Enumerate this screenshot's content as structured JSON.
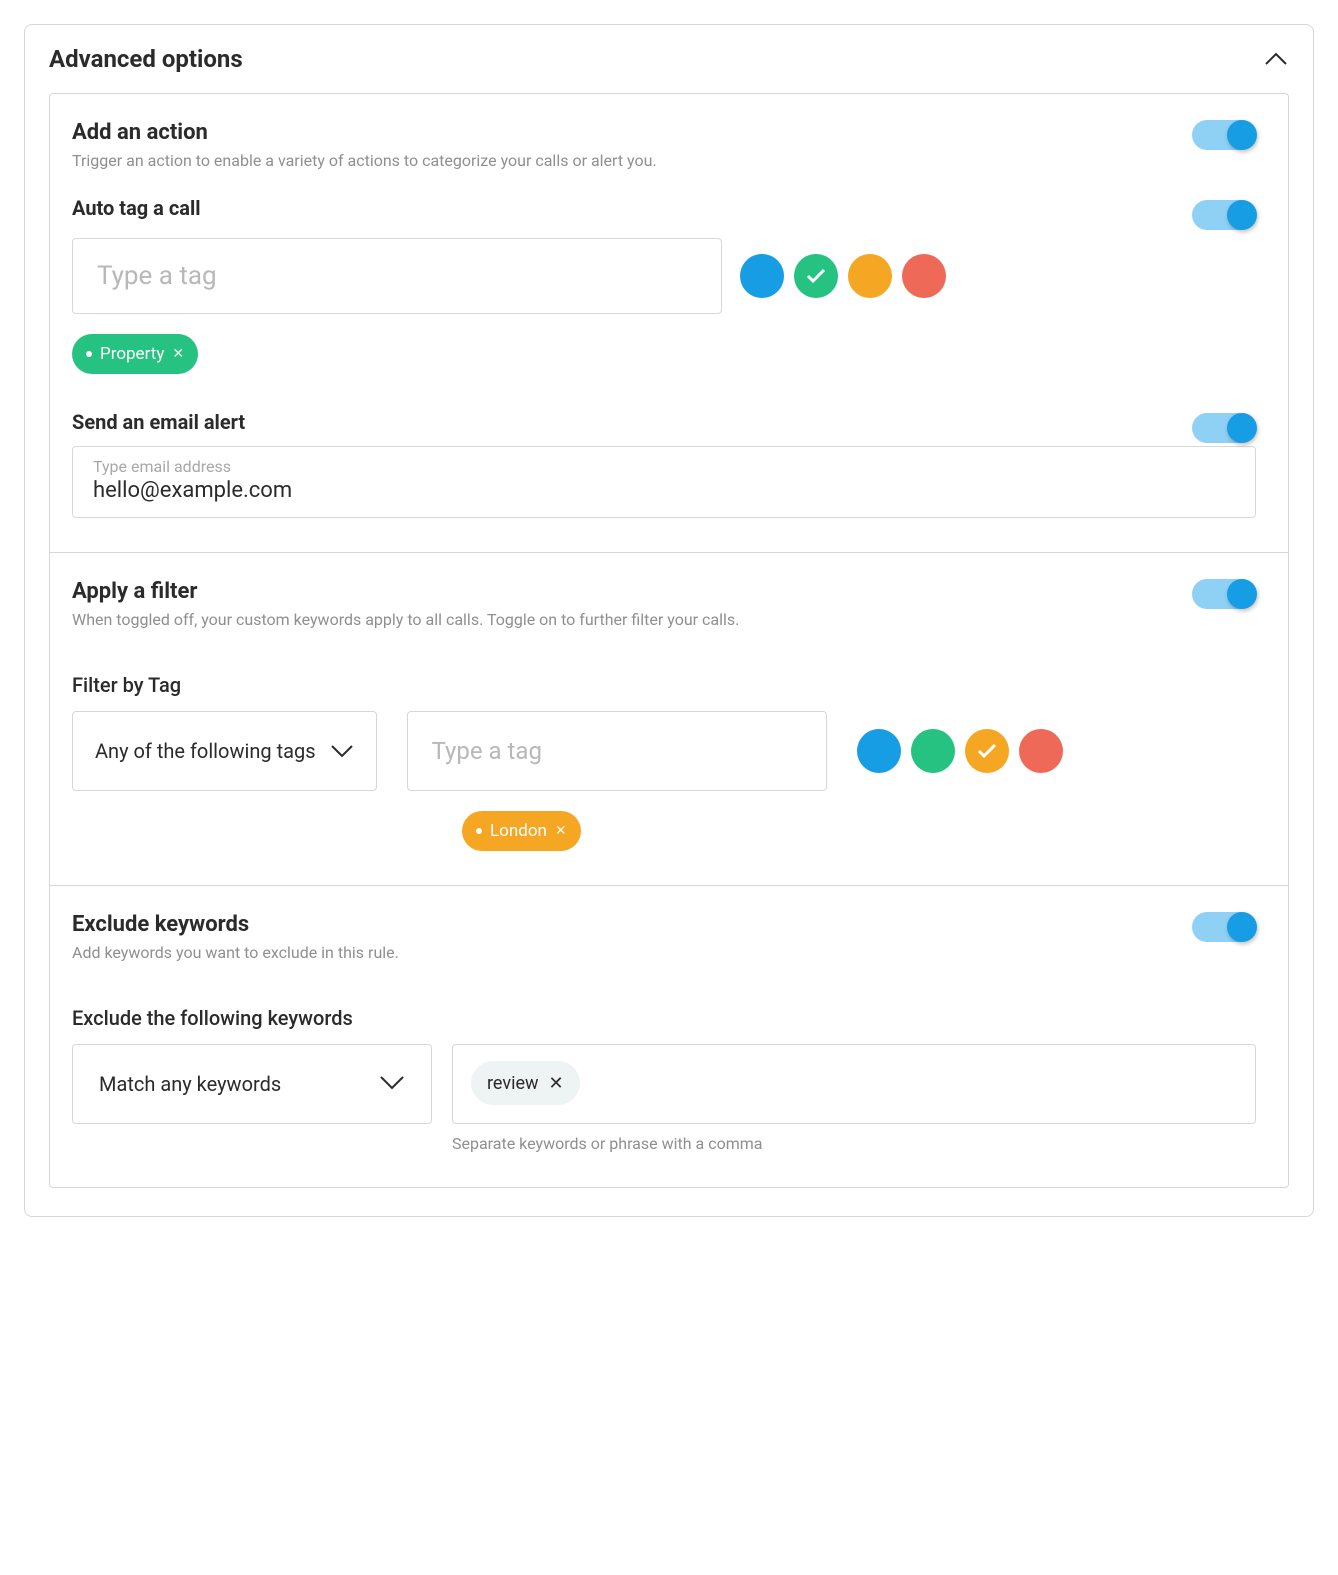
{
  "header": {
    "title": "Advanced options"
  },
  "action": {
    "title": "Add an action",
    "desc": "Trigger an action to enable a variety of actions to categorize your calls or alert you.",
    "autotag": {
      "title": "Auto tag a call",
      "placeholder": "Type a tag",
      "colors": [
        "blue",
        "green",
        "orange",
        "red"
      ],
      "selected_color_index": 1,
      "tags": [
        {
          "label": "Property",
          "color": "#26c281"
        }
      ]
    },
    "email": {
      "title": "Send an email alert",
      "placeholder": "Type email address",
      "value": "hello@example.com"
    }
  },
  "filter": {
    "title": "Apply a filter",
    "desc": "When toggled off, your custom keywords apply to all calls. Toggle on to further filter your calls.",
    "bytag": {
      "label": "Filter by Tag",
      "select": "Any of the following tags",
      "placeholder": "Type a tag",
      "colors": [
        "blue",
        "green",
        "orange",
        "red"
      ],
      "selected_color_index": 2,
      "tags": [
        {
          "label": "London",
          "color": "#f5a623"
        }
      ]
    }
  },
  "exclude": {
    "title": "Exclude keywords",
    "desc": "Add keywords you want to exclude in this rule.",
    "sub_label": "Exclude the following keywords",
    "select": "Match any keywords",
    "keywords": [
      "review"
    ],
    "hint": "Separate keywords or phrase with a comma"
  }
}
